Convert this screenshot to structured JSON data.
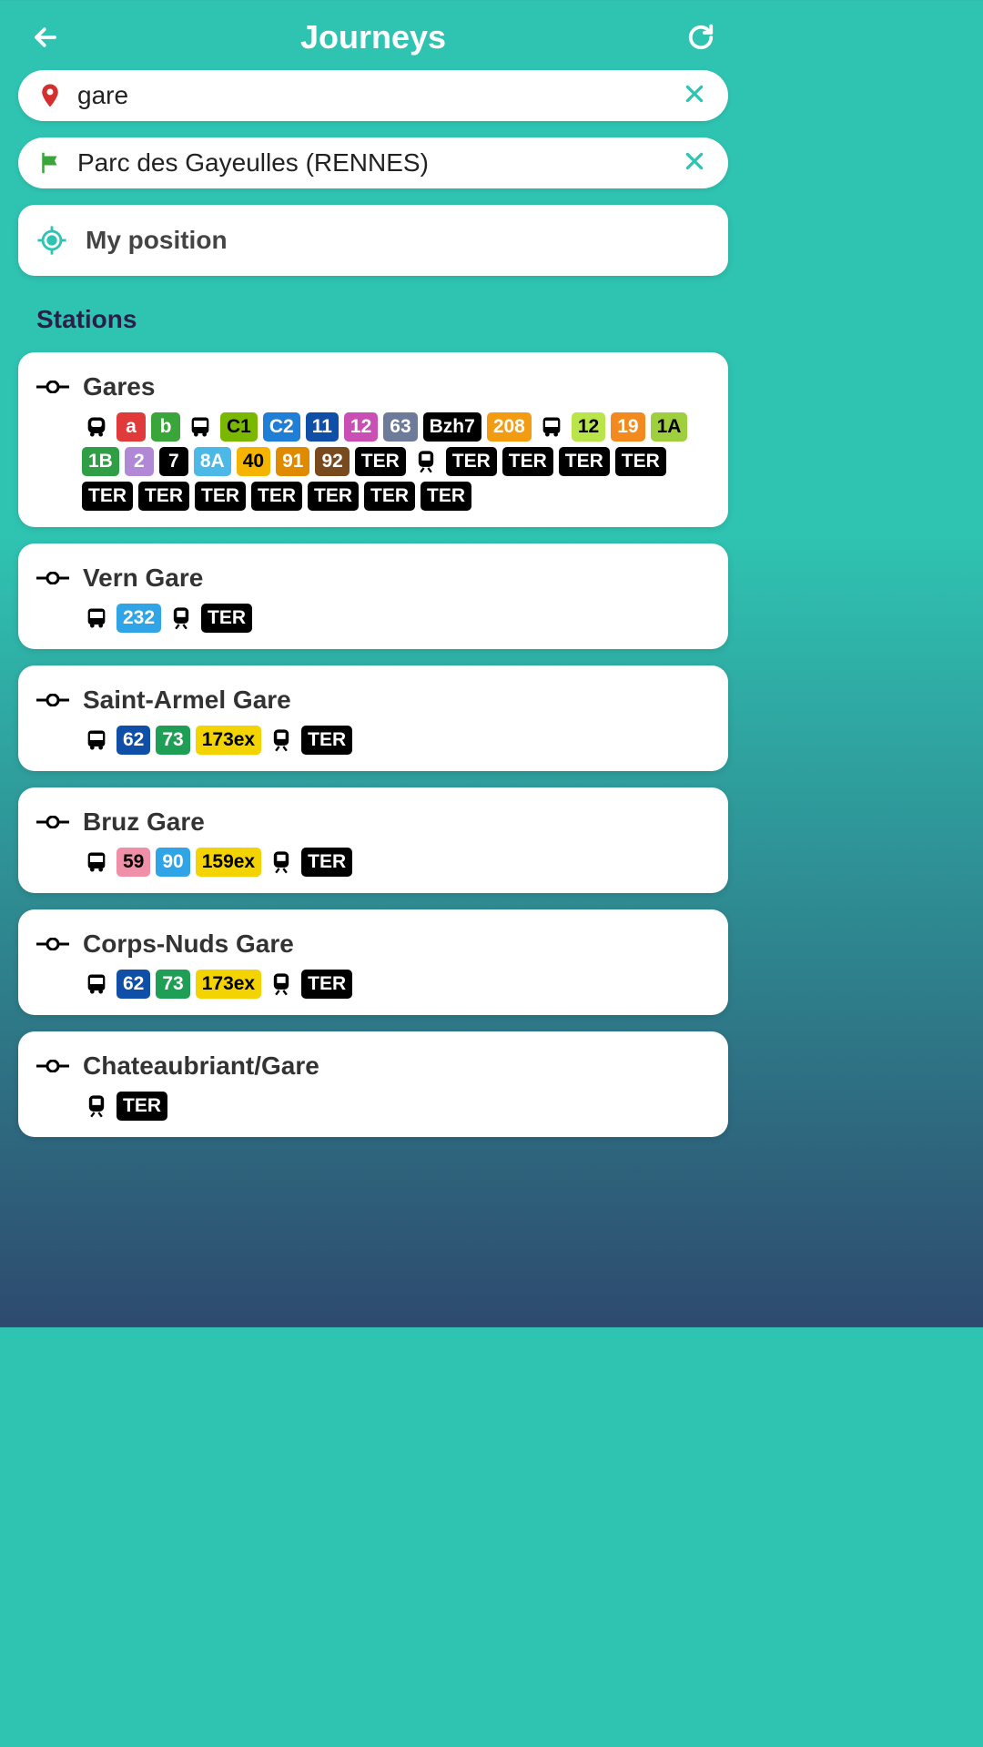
{
  "header": {
    "title": "Journeys"
  },
  "origin": {
    "value": "gare"
  },
  "destination": {
    "value": "Parc des Gayeulles (RENNES)"
  },
  "myPosition": {
    "label": "My position"
  },
  "sectionTitle": "Stations",
  "colors": {
    "teal": "#2fc4b2",
    "red": "#e03a3a",
    "green": "#3aa53a",
    "c1green": "#7ab800",
    "blue": "#1f7ed6",
    "darkblue": "#0f4fa8",
    "magenta": "#c94fb5",
    "slate": "#6e7a99",
    "black": "#000000",
    "orange": "#f39c12",
    "lime": "#b9e54a",
    "orange2": "#f28a1f",
    "limeA": "#9fcf3f",
    "green1B": "#2f9e44",
    "purple": "#b088d6",
    "cyan": "#4bb8e6",
    "gold": "#f4b400",
    "amber": "#e08a00",
    "brown": "#7a4a1f",
    "sky": "#2fa4e7",
    "pink": "#f08fa8",
    "yellow": "#f4d400",
    "green73": "#1f9e55"
  },
  "stations": [
    {
      "name": "Gares",
      "lines": [
        {
          "mode": "metro"
        },
        {
          "t": "a",
          "bg": "red",
          "fg": "#fff"
        },
        {
          "t": "b",
          "bg": "green",
          "fg": "#fff"
        },
        {
          "mode": "bus"
        },
        {
          "t": "C1",
          "bg": "c1green",
          "fg": "#000"
        },
        {
          "t": "C2",
          "bg": "blue",
          "fg": "#fff"
        },
        {
          "t": "11",
          "bg": "darkblue",
          "fg": "#fff"
        },
        {
          "t": "12",
          "bg": "magenta",
          "fg": "#fff"
        },
        {
          "t": "63",
          "bg": "slate",
          "fg": "#fff"
        },
        {
          "t": "Bzh7",
          "bg": "black",
          "fg": "#fff"
        },
        {
          "t": "208",
          "bg": "orange",
          "fg": "#fff"
        },
        {
          "mode": "bus"
        },
        {
          "t": "12",
          "bg": "lime",
          "fg": "#000"
        },
        {
          "t": "19",
          "bg": "orange2",
          "fg": "#fff"
        },
        {
          "t": "1A",
          "bg": "limeA",
          "fg": "#000"
        },
        {
          "t": "1B",
          "bg": "green1B",
          "fg": "#fff"
        },
        {
          "t": "2",
          "bg": "purple",
          "fg": "#fff"
        },
        {
          "t": "7",
          "bg": "black",
          "fg": "#fff"
        },
        {
          "t": "8A",
          "bg": "cyan",
          "fg": "#fff"
        },
        {
          "t": "40",
          "bg": "gold",
          "fg": "#000"
        },
        {
          "t": "91",
          "bg": "amber",
          "fg": "#fff"
        },
        {
          "t": "92",
          "bg": "brown",
          "fg": "#fff"
        },
        {
          "t": "TER",
          "bg": "black",
          "fg": "#fff"
        },
        {
          "mode": "train"
        },
        {
          "t": "TER",
          "bg": "black",
          "fg": "#fff"
        },
        {
          "t": "TER",
          "bg": "black",
          "fg": "#fff"
        },
        {
          "t": "TER",
          "bg": "black",
          "fg": "#fff"
        },
        {
          "t": "TER",
          "bg": "black",
          "fg": "#fff"
        },
        {
          "t": "TER",
          "bg": "black",
          "fg": "#fff"
        },
        {
          "t": "TER",
          "bg": "black",
          "fg": "#fff"
        },
        {
          "t": "TER",
          "bg": "black",
          "fg": "#fff"
        },
        {
          "t": "TER",
          "bg": "black",
          "fg": "#fff"
        },
        {
          "t": "TER",
          "bg": "black",
          "fg": "#fff"
        },
        {
          "t": "TER",
          "bg": "black",
          "fg": "#fff"
        },
        {
          "t": "TER",
          "bg": "black",
          "fg": "#fff"
        }
      ]
    },
    {
      "name": "Vern Gare",
      "lines": [
        {
          "mode": "bus"
        },
        {
          "t": "232",
          "bg": "sky",
          "fg": "#fff"
        },
        {
          "mode": "train"
        },
        {
          "t": "TER",
          "bg": "black",
          "fg": "#fff"
        }
      ]
    },
    {
      "name": "Saint-Armel Gare",
      "lines": [
        {
          "mode": "bus"
        },
        {
          "t": "62",
          "bg": "darkblue",
          "fg": "#fff"
        },
        {
          "t": "73",
          "bg": "green73",
          "fg": "#fff"
        },
        {
          "t": "173ex",
          "bg": "yellow",
          "fg": "#000"
        },
        {
          "mode": "train"
        },
        {
          "t": "TER",
          "bg": "black",
          "fg": "#fff"
        }
      ]
    },
    {
      "name": "Bruz Gare",
      "lines": [
        {
          "mode": "bus"
        },
        {
          "t": "59",
          "bg": "pink",
          "fg": "#000"
        },
        {
          "t": "90",
          "bg": "sky",
          "fg": "#fff"
        },
        {
          "t": "159ex",
          "bg": "yellow",
          "fg": "#000"
        },
        {
          "mode": "train"
        },
        {
          "t": "TER",
          "bg": "black",
          "fg": "#fff"
        }
      ]
    },
    {
      "name": "Corps-Nuds Gare",
      "lines": [
        {
          "mode": "bus"
        },
        {
          "t": "62",
          "bg": "darkblue",
          "fg": "#fff"
        },
        {
          "t": "73",
          "bg": "green73",
          "fg": "#fff"
        },
        {
          "t": "173ex",
          "bg": "yellow",
          "fg": "#000"
        },
        {
          "mode": "train"
        },
        {
          "t": "TER",
          "bg": "black",
          "fg": "#fff"
        }
      ]
    },
    {
      "name": "Chateaubriant/Gare",
      "lines": [
        {
          "mode": "train"
        },
        {
          "t": "TER",
          "bg": "black",
          "fg": "#fff"
        }
      ]
    }
  ]
}
